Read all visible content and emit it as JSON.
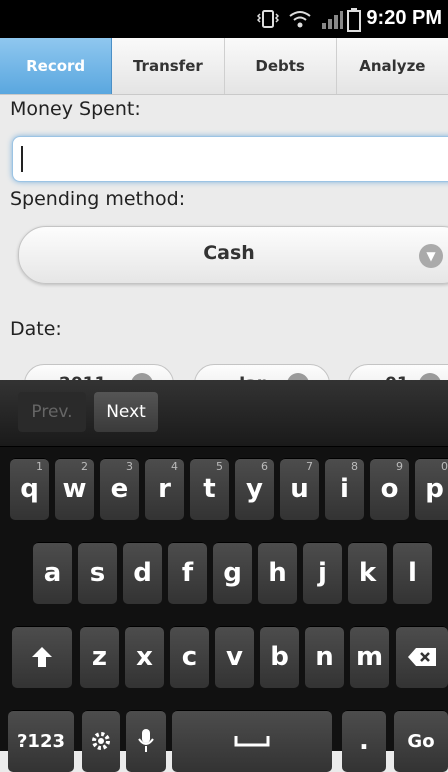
{
  "status": {
    "time": "9:20 PM",
    "icons": [
      "vibrate-icon",
      "wifi-icon",
      "signal-icon",
      "battery-icon"
    ]
  },
  "tabs": [
    "Record",
    "Transfer",
    "Debts",
    "Analyze"
  ],
  "form": {
    "money_label": "Money Spent:",
    "money_value": "",
    "method_label": "Spending method:",
    "method_value": "Cash",
    "date_label": "Date:",
    "date_year": "2011",
    "date_month": "Jan",
    "date_day": "01"
  },
  "keyboard": {
    "prev": "Prev.",
    "next": "Next",
    "row1": [
      "q",
      "w",
      "e",
      "r",
      "t",
      "y",
      "u",
      "i",
      "o",
      "p"
    ],
    "row1_nums": [
      "1",
      "2",
      "3",
      "4",
      "5",
      "6",
      "7",
      "8",
      "9",
      "0"
    ],
    "row2": [
      "a",
      "s",
      "d",
      "f",
      "g",
      "h",
      "j",
      "k",
      "l"
    ],
    "row3": [
      "z",
      "x",
      "c",
      "v",
      "b",
      "n",
      "m"
    ],
    "sym": "?123",
    "period": ".",
    "go": "Go"
  },
  "colors": {
    "accent": "#5aa7df",
    "keyboard_bg": "#111111"
  }
}
